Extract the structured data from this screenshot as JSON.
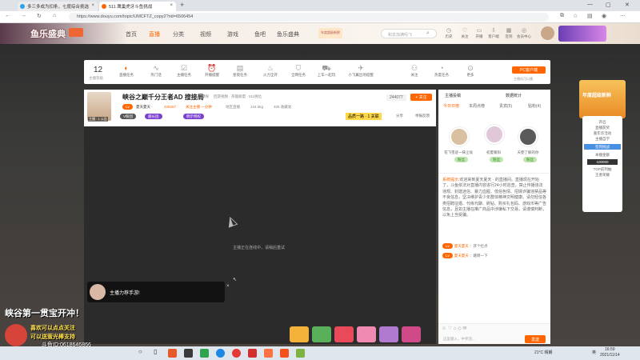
{
  "browser": {
    "tabs": [
      {
        "title": "多三多成为扣条，七度综合挑选"
      },
      {
        "title": "511 鹰巢虎牙斗鱼挑战"
      }
    ],
    "new_tab": "+",
    "url": "https://www.douyu.com/topic/UMCFTZ_copy2?rid=6506454"
  },
  "site": {
    "logo": "鱼乐盛典",
    "nav": [
      "首页",
      "直播",
      "分类",
      "视频",
      "游戏",
      "鱼吧",
      "鱼乐盛典"
    ],
    "search_placeholder": "和去加满吗飞",
    "top_icons": [
      "历史",
      "关注",
      "开播",
      "客户端",
      "签到",
      "会员中心"
    ],
    "badge": "年度超级新鲜"
  },
  "taskbar": {
    "level_num": "12",
    "level_label": "主播等级",
    "items": [
      "直播任务",
      "热门话",
      "主播任务",
      "开播提醒",
      "星夜任务",
      "火力全开",
      "全网任务",
      "上车一起玩",
      "小飞翼出场提醒",
      "关注",
      "热度任务",
      "更多"
    ],
    "pc_button": "PC客户端",
    "pc_sub": "主播尚可以播"
  },
  "stream": {
    "avatar_label": "主播 · 1 公告",
    "follow_label": "+ 关注",
    "title": "峡谷之巅千分王者AD 搜接局",
    "tag1": "爆探",
    "meta": [
      "回游视频 · 英雄联盟 · 511挑位"
    ],
    "host_name": "夏天夏天 ·",
    "stat1": "425267",
    "stat2": "关注主播 一分钟",
    "stat3": "地区直播",
    "stat4": "134.5kg",
    "stat5": "405 收藏发",
    "room_num": "244077",
    "follow_btn": "+ 关注",
    "chips": [
      "V粉团",
      "舰长团",
      "明示特权",
      "直播签到 ·"
    ],
    "highlight": "品质一路 · 1 关联",
    "share": "分享",
    "report": "举报反馈",
    "video_msg": "主播正在连线中，请稍后重试",
    "toast": "主播力荐手游!"
  },
  "chat": {
    "header_tabs": [
      "主播投稿",
      "数据统计"
    ],
    "tabs": [
      "今日日榜",
      "本周点榜",
      "贵宾(5)",
      "贴粉(4)"
    ],
    "top_fans": [
      {
        "name": "花飞雪迹一抹尘埃",
        "badge": "粉丝"
      },
      {
        "name": "初夏暖阳",
        "badge": "粉丝"
      },
      {
        "name": "天使了解的你",
        "badge": "粉丝"
      }
    ],
    "system_title": "系统提示:",
    "system_msg": "欢迎来到夏天夏天 · 的直播间。直播现在开始了，斗鱼依法对直播内容进行24小时巡查，禁止传播违法违规、封建迷信、暴力血腥、低俗色情、招嫖诈骗违禁品等不良信息，坚决维护青少年群体精神文明健康。请勿轻信各类招聘征婚、代练代聊、刷钻、购买礼包码、游戏币等广告信息，且如主播在推广商品中涉嫌私下交易，请谨慎判断，以免上当受骗。",
    "user_lines": [
      {
        "user": "夏天夏天",
        "text": "开个拦点"
      },
      {
        "user": "夏天夏天",
        "text": "跳转一下"
      }
    ],
    "input_placeholder": "这里输入，中奖话...",
    "send": "发送"
  },
  "right_ads": {
    "ad1": "年度超级新鲜",
    "ad2_lines": [
      "开启",
      "直播获奖",
      "嘉年华活动",
      "主播自学",
      "签到挑战",
      "本播金额",
      "100000",
      "TOP前列抽",
      "王者荣耀"
    ]
  },
  "bottom": {
    "banner": "峡谷第一贯宝开冲！",
    "sub1": "喜欢可以点点关注",
    "sub2": "可以送萤光棒支持",
    "id_text": "斗鱼ID:0618646866"
  },
  "system": {
    "temp": "21°C 晴朗",
    "time": "16:59",
    "date": "2021/11/14",
    "lang": "英"
  }
}
